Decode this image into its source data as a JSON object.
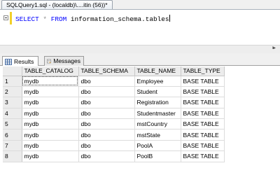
{
  "document_tab": {
    "title": "SQLQuery1.sql - (localdb)\\....itin (56))*"
  },
  "editor": {
    "query": {
      "kw1": "SELECT",
      "star": "*",
      "kw2": "FROM",
      "table": "information_schema.tables"
    }
  },
  "results_tabs": [
    {
      "label": "Results",
      "icon": "grid-icon"
    },
    {
      "label": "Messages",
      "icon": "messages-icon"
    }
  ],
  "grid": {
    "columns": [
      "TABLE_CATALOG",
      "TABLE_SCHEMA",
      "TABLE_NAME",
      "TABLE_TYPE"
    ],
    "rows": [
      {
        "n": "1",
        "catalog": "mydb",
        "schema": "dbo",
        "name": "Employee",
        "type": "BASE TABLE"
      },
      {
        "n": "2",
        "catalog": "mydb",
        "schema": "dbo",
        "name": "Student",
        "type": "BASE TABLE"
      },
      {
        "n": "3",
        "catalog": "mydb",
        "schema": "dbo",
        "name": "Registration",
        "type": "BASE TABLE"
      },
      {
        "n": "4",
        "catalog": "mydb",
        "schema": "dbo",
        "name": "Studentmaster",
        "type": "BASE TABLE"
      },
      {
        "n": "5",
        "catalog": "mydb",
        "schema": "dbo",
        "name": "mstCountry",
        "type": "BASE TABLE"
      },
      {
        "n": "6",
        "catalog": "mydb",
        "schema": "dbo",
        "name": "mstState",
        "type": "BASE TABLE"
      },
      {
        "n": "7",
        "catalog": "mydb",
        "schema": "dbo",
        "name": "PoolA",
        "type": "BASE TABLE"
      },
      {
        "n": "8",
        "catalog": "mydb",
        "schema": "dbo",
        "name": "PoolB",
        "type": "BASE TABLE"
      }
    ]
  },
  "colors": {
    "keyword": "#0000ff",
    "margin_marker": "#f2cf28"
  }
}
